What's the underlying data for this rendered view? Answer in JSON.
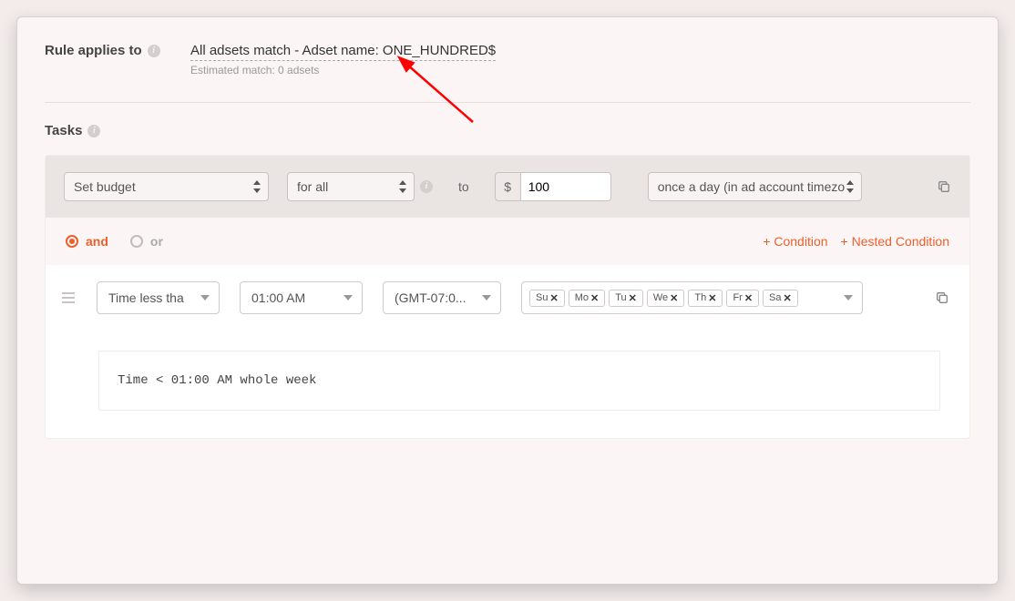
{
  "ruleApplies": {
    "label": "Rule applies to",
    "value": "All adsets match - Adset name: ONE_HUNDRED$",
    "estimated": "Estimated match: 0 adsets"
  },
  "tasks": {
    "header": "Tasks",
    "action": "Set budget",
    "scope": "for all",
    "toLabel": "to",
    "currency": "$",
    "amount": "100",
    "schedule": "once a day (in ad account timezo",
    "logic": {
      "and": "and",
      "or": "or",
      "addCondition": "+ Condition",
      "addNested": "+ Nested Condition"
    },
    "condition": {
      "field": "Time less tha",
      "time": "01:00 AM",
      "tz": "(GMT-07:0...",
      "days": [
        "Su",
        "Mo",
        "Tu",
        "We",
        "Th",
        "Fr",
        "Sa"
      ]
    },
    "summary": "Time < 01:00 AM whole week"
  }
}
